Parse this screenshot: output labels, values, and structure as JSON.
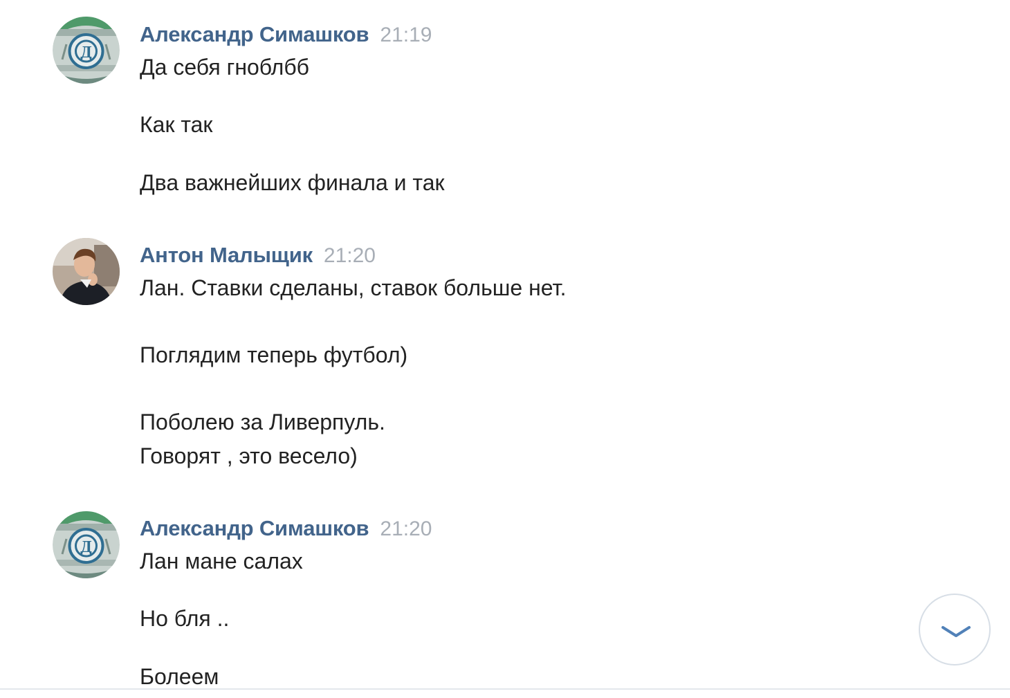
{
  "messages": [
    {
      "author": "Александр Симашков",
      "time": "21:19",
      "avatar_icon": "dynamo-club-logo-icon",
      "lines": [
        "Да себя гноблбб",
        "Как так",
        "Два важнейших финала и так"
      ]
    },
    {
      "author": "Антон Малыщик",
      "time": "21:20",
      "avatar_icon": "user-photo-icon",
      "lines": [
        "Лан. Ставки сделаны, ставок больше нет.",
        "Поглядим теперь футбол)",
        "Поболею за Ливерпуль.",
        "Говорят , это весело)"
      ]
    },
    {
      "author": "Александр Симашков",
      "time": "21:20",
      "avatar_icon": "dynamo-club-logo-icon",
      "lines": [
        "Лан мане салах",
        "Но бля ..",
        "Болеем"
      ]
    }
  ],
  "scroll_button": {
    "icon": "chevron-down-icon"
  },
  "colors": {
    "author": "#42648b",
    "time": "#a8aeb6",
    "text": "#222222",
    "button_border": "#d7dee6",
    "chevron": "#5181b8"
  }
}
